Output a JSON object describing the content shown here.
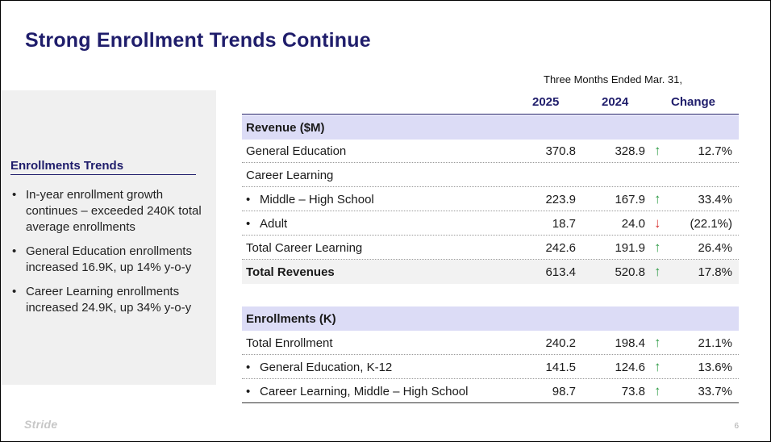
{
  "title": "Strong Enrollment Trends Continue",
  "sidebar": {
    "heading": "Enrollments Trends",
    "bullets": [
      "In-year enrollment growth continues – exceeded 240K total average enrollments",
      "General Education enrollments increased 16.9K, up 14% y-o-y",
      "Career Learning enrollments increased 24.9K, up 34% y-o-y"
    ]
  },
  "table": {
    "period": "Three Months Ended Mar. 31,",
    "columns": [
      "2025",
      "2024",
      "Change"
    ],
    "revenue": {
      "header": "Revenue ($M)",
      "rows": [
        {
          "label": "General Education",
          "v2025": "370.8",
          "v2024": "328.9",
          "arrow": "↑",
          "change": "12.7%"
        },
        {
          "label": "Career Learning"
        },
        {
          "label": "Middle – High School",
          "v2025": "223.9",
          "v2024": "167.9",
          "arrow": "↑",
          "change": "33.4%"
        },
        {
          "label": "Adult",
          "v2025": "18.7",
          "v2024": "24.0",
          "arrow": "↓",
          "change": "(22.1%)"
        },
        {
          "label": "Total Career Learning",
          "v2025": "242.6",
          "v2024": "191.9",
          "arrow": "↑",
          "change": "26.4%"
        },
        {
          "label": "Total Revenues",
          "v2025": "613.4",
          "v2024": "520.8",
          "arrow": "↑",
          "change": "17.8%"
        }
      ]
    },
    "enrollments": {
      "header": "Enrollments (K)",
      "rows": [
        {
          "label": "Total Enrollment",
          "v2025": "240.2",
          "v2024": "198.4",
          "arrow": "↑",
          "change": "21.1%"
        },
        {
          "label": "General Education, K-12",
          "v2025": "141.5",
          "v2024": "124.6",
          "arrow": "↑",
          "change": "13.6%"
        },
        {
          "label": "Career Learning, Middle – High School",
          "v2025": "98.7",
          "v2024": "73.8",
          "arrow": "↑",
          "change": "33.7%"
        }
      ]
    },
    "bullet_char": "•"
  },
  "footer": {
    "logo": "Stride",
    "page_number": "6"
  }
}
